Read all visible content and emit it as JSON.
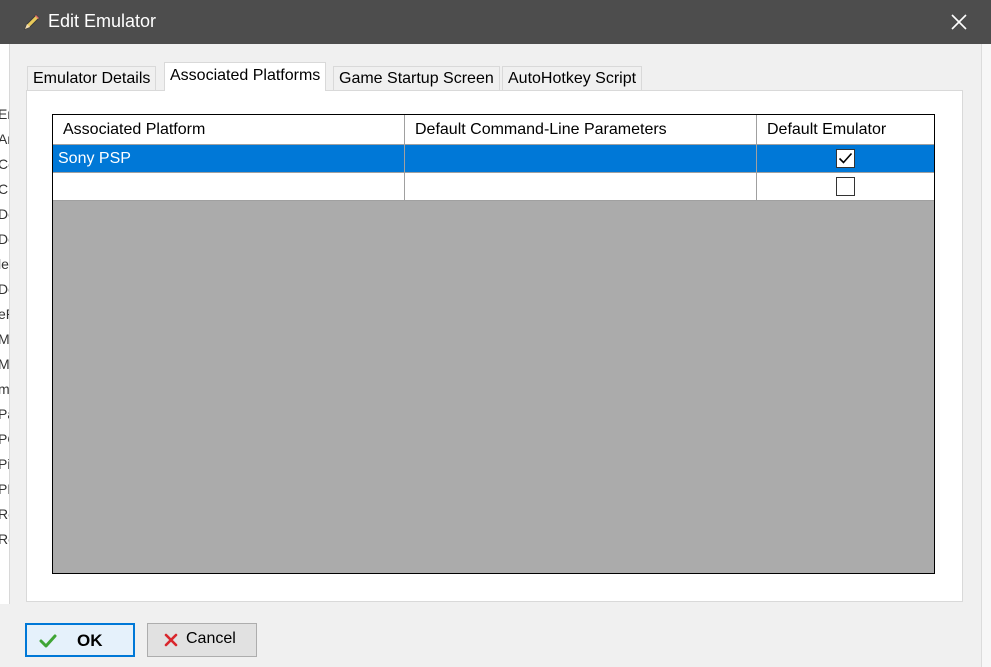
{
  "window": {
    "title": "Edit Emulator"
  },
  "background_fragments": [
    "En",
    "Ar",
    "Ce",
    "Ci",
    "Do",
    "Do",
    "le",
    "Do",
    "eP",
    "M",
    "M",
    "m",
    "Pa",
    "PC",
    "Pi",
    "PP",
    "Re",
    "Re"
  ],
  "tabs": [
    {
      "label": "Emulator Details",
      "active": false
    },
    {
      "label": "Associated Platforms",
      "active": true
    },
    {
      "label": "Game Startup Screen",
      "active": false
    },
    {
      "label": "AutoHotkey Script",
      "active": false
    }
  ],
  "grid": {
    "columns": [
      "Associated Platform",
      "Default Command-Line Parameters",
      "Default Emulator"
    ],
    "rows": [
      {
        "platform": "Sony PSP",
        "parameters": "",
        "default_emulator": true,
        "selected": true
      },
      {
        "platform": "",
        "parameters": "",
        "default_emulator": false,
        "selected": false
      }
    ]
  },
  "buttons": {
    "ok_label": "OK",
    "cancel_label": "Cancel"
  },
  "colors": {
    "titlebar": "#4d4d4d",
    "selection": "#0078d7",
    "grid_empty": "#ababab",
    "ok_check": "#3fa535",
    "cancel_x": "#d9262c"
  },
  "icons": {
    "app": "pencil-icon",
    "close": "close-icon",
    "ok": "checkmark-icon",
    "cancel": "x-icon"
  }
}
